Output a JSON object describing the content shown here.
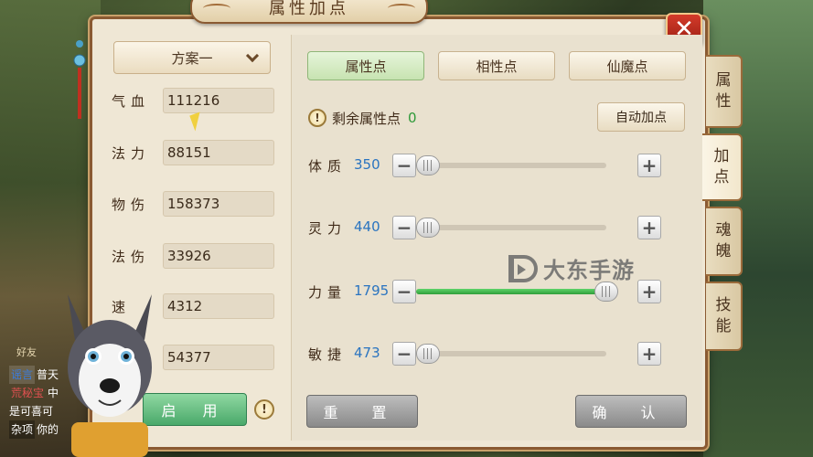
{
  "window": {
    "title": "属性加点",
    "close_icon": "close-icon"
  },
  "left": {
    "plan": "方案一",
    "stats": [
      {
        "label": "气血",
        "value": "111216"
      },
      {
        "label": "法力",
        "value": "88151"
      },
      {
        "label": "物伤",
        "value": "158373"
      },
      {
        "label": "法伤",
        "value": "33926"
      },
      {
        "label": "速",
        "value": "4312"
      },
      {
        "label": "",
        "value": "54377"
      }
    ],
    "enable_label": "启 用",
    "warning_mark": "!"
  },
  "tabs": [
    {
      "label": "属性点",
      "active": true
    },
    {
      "label": "相性点",
      "active": false
    },
    {
      "label": "仙魔点",
      "active": false
    }
  ],
  "remaining": {
    "icon": "!",
    "label": "剩余属性点",
    "value": "0"
  },
  "auto_label": "自动加点",
  "attributes": [
    {
      "label": "体质",
      "value": "350",
      "level": 0.0
    },
    {
      "label": "灵力",
      "value": "440",
      "level": 0.0
    },
    {
      "label": "力量",
      "value": "1795",
      "level": 1.0
    },
    {
      "label": "敏捷",
      "value": "473",
      "level": 0.0
    }
  ],
  "buttons": {
    "minus": "−",
    "plus": "+",
    "reset": "重 置",
    "confirm": "确 认"
  },
  "side_tabs": [
    {
      "label": "属\n性",
      "active": false
    },
    {
      "label": "加\n点",
      "active": true
    },
    {
      "label": "魂\n魄",
      "active": false
    },
    {
      "label": "技\n能",
      "active": false
    }
  ],
  "watermark": "大东手游",
  "chat": {
    "friend": "好友",
    "lines": [
      {
        "tag": "谣言",
        "text": "普天"
      },
      {
        "tag": "荒秘宝",
        "text": "中"
      },
      {
        "tag": "",
        "text": "是可喜可"
      },
      {
        "tag": "杂项",
        "text": "你的"
      }
    ]
  },
  "colors": {
    "accent_green": "#4aa96a",
    "attr_blue": "#2a74c0",
    "remaining_green": "#2f9a3a",
    "close_red": "#c03020"
  }
}
